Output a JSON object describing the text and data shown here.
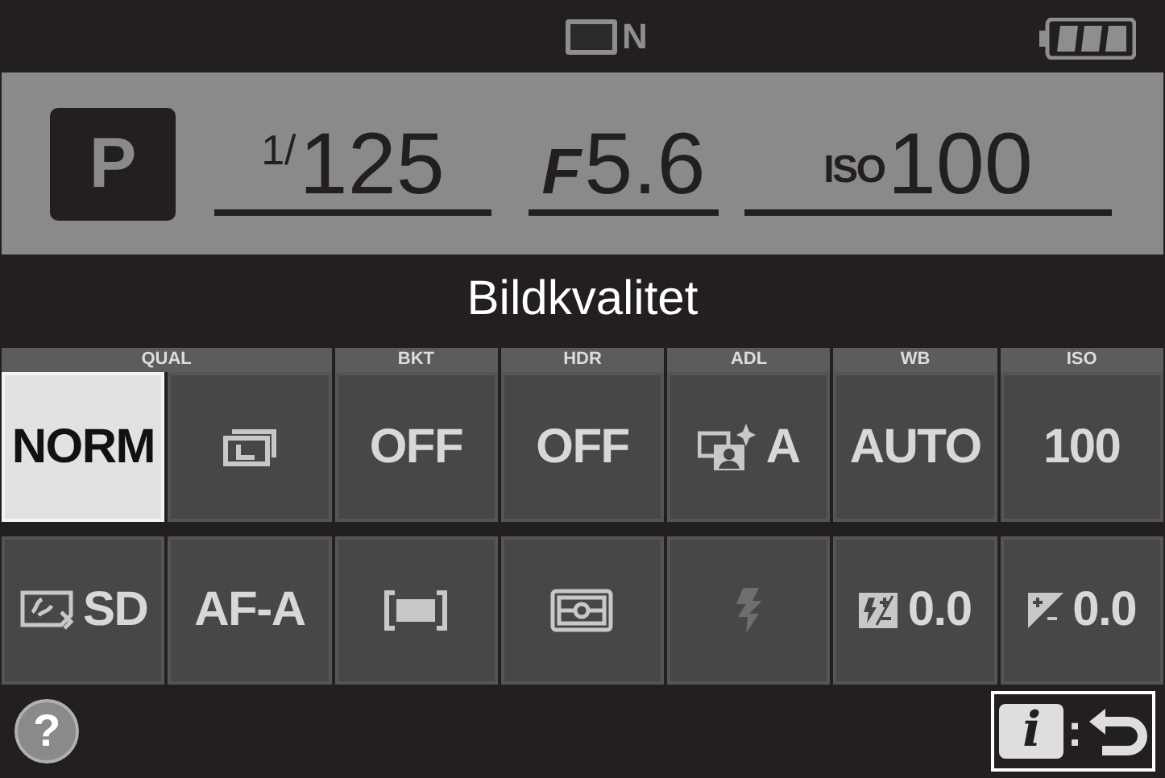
{
  "status_bar": {
    "release_mode": "N"
  },
  "exposure": {
    "mode": "P",
    "shutter": {
      "prefix": "1/",
      "value": "125"
    },
    "aperture": {
      "prefix": "F",
      "value": "5.6"
    },
    "iso": {
      "prefix": "ISO",
      "value": "100"
    }
  },
  "title": "Bildkvalitet",
  "settings_groups": [
    {
      "header": "QUAL",
      "cells": [
        {
          "kind": "text",
          "text": "NORM",
          "selected": true
        },
        {
          "kind": "size",
          "selected": false
        }
      ]
    },
    {
      "header": "BKT",
      "cells": [
        {
          "kind": "text",
          "text": "OFF",
          "selected": false
        }
      ]
    },
    {
      "header": "HDR",
      "cells": [
        {
          "kind": "text",
          "text": "OFF",
          "selected": false
        }
      ]
    },
    {
      "header": "ADL",
      "cells": [
        {
          "kind": "dlighting",
          "text": "A",
          "selected": false
        }
      ]
    },
    {
      "header": "WB",
      "cells": [
        {
          "kind": "text",
          "text": "AUTO",
          "selected": false
        }
      ]
    },
    {
      "header": "ISO",
      "cells": [
        {
          "kind": "text",
          "text": "100",
          "selected": false
        }
      ]
    }
  ],
  "settings_row_2": [
    {
      "kind": "picture",
      "text": "SD",
      "selected": false
    },
    {
      "kind": "text",
      "text": "AF-A",
      "selected": false
    },
    {
      "kind": "area",
      "selected": false
    },
    {
      "kind": "metering",
      "selected": false
    },
    {
      "kind": "flash",
      "selected": false
    },
    {
      "kind": "flashcomp",
      "text": "0.0",
      "selected": false
    },
    {
      "kind": "expcomp",
      "text": "0.0",
      "selected": false
    }
  ],
  "footer": {
    "help": "?",
    "info_key": "i",
    "separator": ":"
  }
}
